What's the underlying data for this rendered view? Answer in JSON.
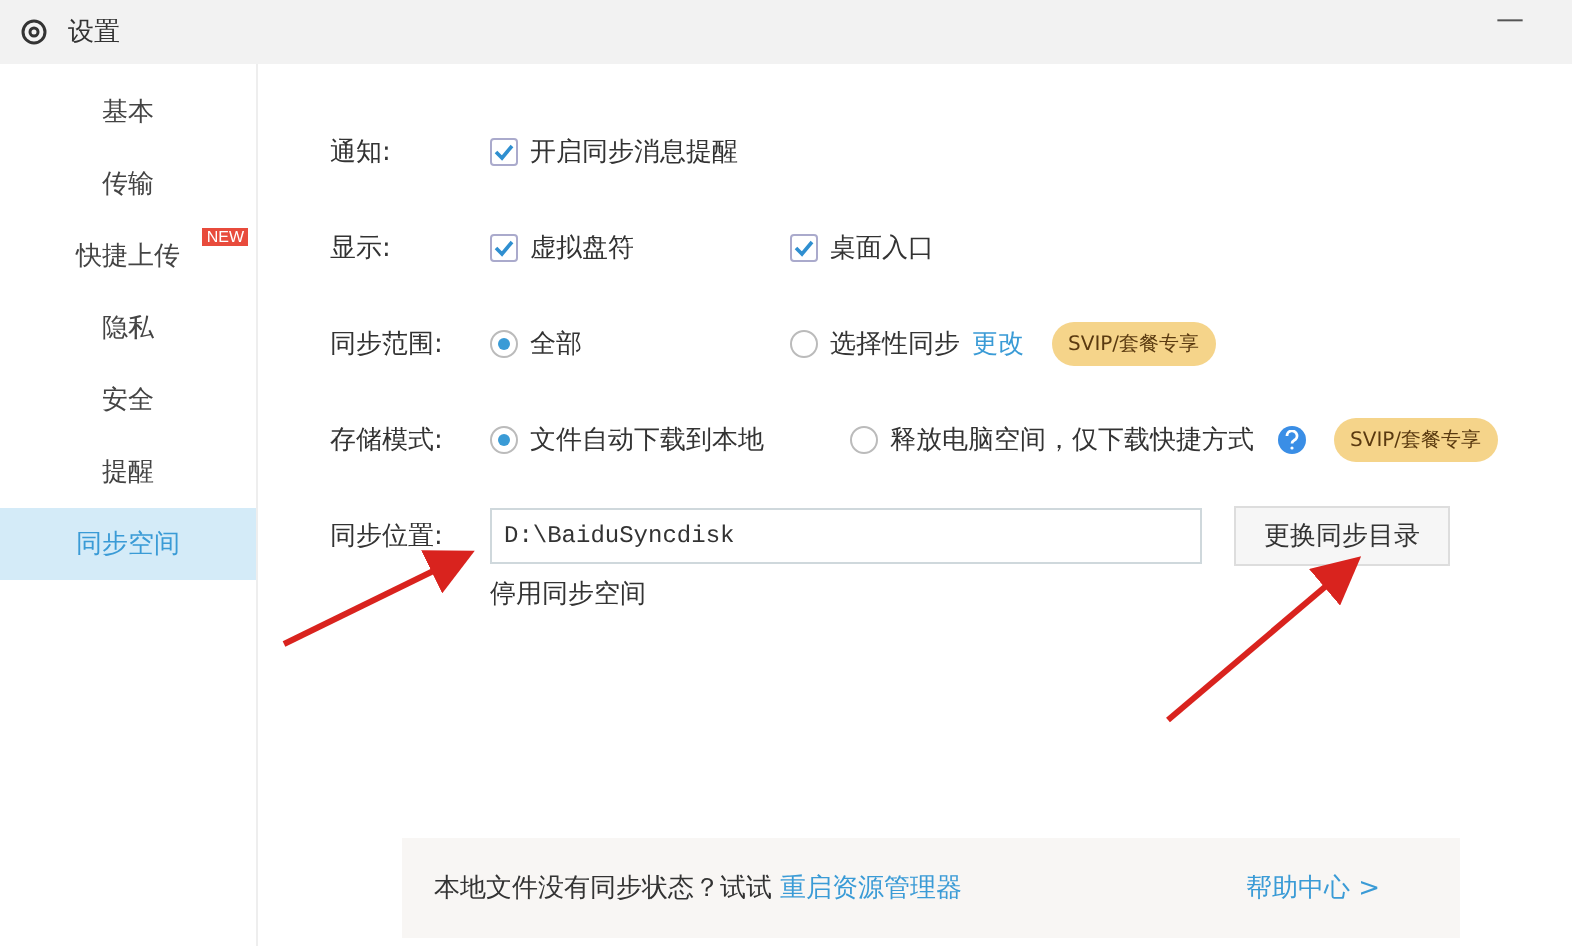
{
  "window": {
    "title": "设置",
    "minimize": "—"
  },
  "sidebar": {
    "items": [
      {
        "label": "基本",
        "selected": false
      },
      {
        "label": "传输",
        "selected": false
      },
      {
        "label": "快捷上传",
        "selected": false,
        "badge": "NEW"
      },
      {
        "label": "隐私",
        "selected": false
      },
      {
        "label": "安全",
        "selected": false
      },
      {
        "label": "提醒",
        "selected": false
      },
      {
        "label": "同步空间",
        "selected": true
      }
    ]
  },
  "settings": [
    {
      "kind": "checkbox",
      "label": "通知:",
      "options": [
        {
          "label": "开启同步消息提醒",
          "checked": true
        }
      ]
    },
    {
      "kind": "checkbox",
      "label": "显示:",
      "options": [
        {
          "label": "虚拟盘符",
          "checked": true
        },
        {
          "label": "桌面入口",
          "checked": true
        }
      ]
    },
    {
      "kind": "radio",
      "label": "同步范围:",
      "options": [
        {
          "label": "全部",
          "selected": true
        },
        {
          "label": "选择性同步",
          "selected": false,
          "link": "更改",
          "tag": "SVIP/套餐专享"
        }
      ]
    },
    {
      "kind": "radio",
      "label": "存储模式:",
      "options": [
        {
          "label": "文件自动下载到本地",
          "selected": true
        },
        {
          "label": "释放电脑空间，仅下载快捷方式",
          "selected": false,
          "help": true,
          "tag": "SVIP/套餐专享"
        }
      ]
    }
  ],
  "location": {
    "label": "同步位置:",
    "value": "D:\\BaiduSyncdisk",
    "button": "更换同步目录",
    "disable_link": "停用同步空间"
  },
  "footer": {
    "text": "本地文件没有同步状态？试试",
    "link": "重启资源管理器",
    "help": "帮助中心 >"
  }
}
